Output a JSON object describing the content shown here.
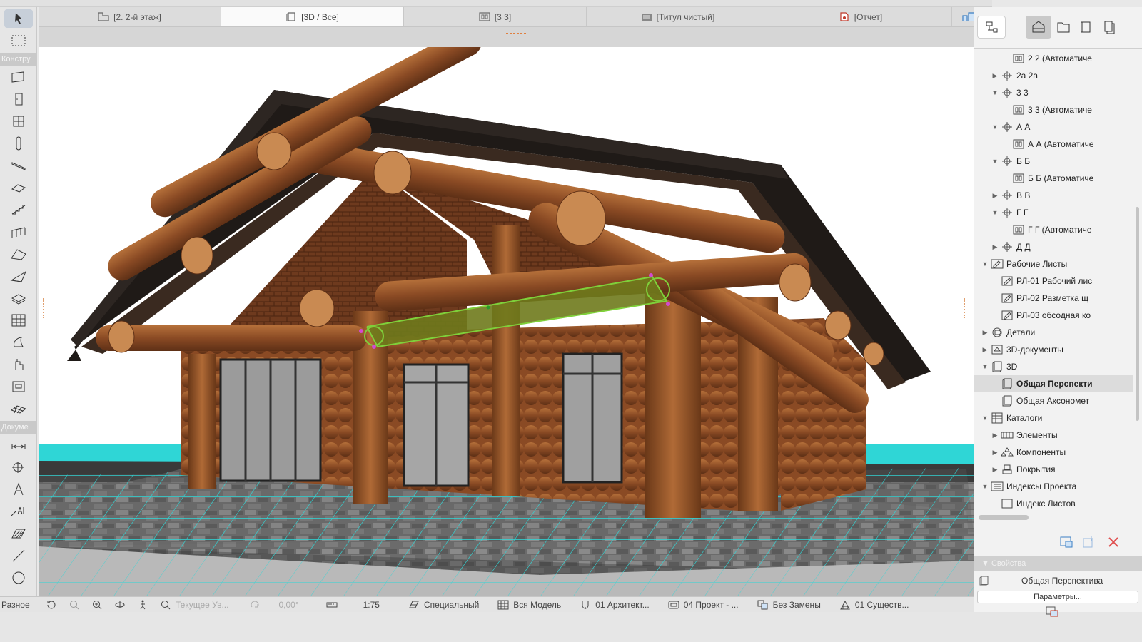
{
  "tabs": [
    {
      "label": "[2. 2-й этаж]",
      "icon": "floor-plan-icon",
      "active": false
    },
    {
      "label": "[3D / Все]",
      "icon": "3d-window-icon",
      "active": true
    },
    {
      "label": "[3 3]",
      "icon": "section-icon",
      "active": false
    },
    {
      "label": "[Титул чистый]",
      "icon": "layout-icon",
      "active": false
    },
    {
      "label": "[Отчет]",
      "icon": "report-icon",
      "active": false
    }
  ],
  "toolbox": {
    "section_design": "Констру",
    "section_document": "Докуме",
    "section_more": "Разное"
  },
  "navigator": {
    "tree": [
      {
        "label": "2 2 (Автоматиче",
        "level": 3,
        "arrow": "",
        "icon": "section-view-icon"
      },
      {
        "label": "2а 2а",
        "level": 2,
        "arrow": "▶",
        "icon": "section-marker-icon"
      },
      {
        "label": "3 3",
        "level": 2,
        "arrow": "▼",
        "icon": "section-marker-icon"
      },
      {
        "label": "3 3 (Автоматиче",
        "level": 3,
        "arrow": "",
        "icon": "section-view-icon"
      },
      {
        "label": "А А",
        "level": 2,
        "arrow": "▼",
        "icon": "section-marker-icon"
      },
      {
        "label": "А А (Автоматиче",
        "level": 3,
        "arrow": "",
        "icon": "section-view-icon"
      },
      {
        "label": "Б Б",
        "level": 2,
        "arrow": "▼",
        "icon": "section-marker-icon"
      },
      {
        "label": "Б Б (Автоматиче",
        "level": 3,
        "arrow": "",
        "icon": "section-view-icon"
      },
      {
        "label": "В В",
        "level": 2,
        "arrow": "▶",
        "icon": "section-marker-icon"
      },
      {
        "label": "Г Г",
        "level": 2,
        "arrow": "▼",
        "icon": "section-marker-icon"
      },
      {
        "label": "Г Г (Автоматиче",
        "level": 3,
        "arrow": "",
        "icon": "section-view-icon"
      },
      {
        "label": "Д Д",
        "level": 2,
        "arrow": "▶",
        "icon": "section-marker-icon"
      },
      {
        "label": "Рабочие Листы",
        "level": 1,
        "arrow": "▼",
        "icon": "worksheet-folder-icon"
      },
      {
        "label": "РЛ-01 Рабочий лис",
        "level": 2,
        "arrow": "",
        "icon": "worksheet-icon"
      },
      {
        "label": "РЛ-02 Разметка щ",
        "level": 2,
        "arrow": "",
        "icon": "worksheet-icon"
      },
      {
        "label": "РЛ-03 обсодная ко",
        "level": 2,
        "arrow": "",
        "icon": "worksheet-icon"
      },
      {
        "label": "Детали",
        "level": 1,
        "arrow": "▶",
        "icon": "details-icon"
      },
      {
        "label": "3D-документы",
        "level": 1,
        "arrow": "▶",
        "icon": "3d-document-icon"
      },
      {
        "label": "3D",
        "level": 1,
        "arrow": "▼",
        "icon": "3d-folder-icon"
      },
      {
        "label": "Общая Перспекти",
        "level": 2,
        "arrow": "",
        "icon": "perspective-icon",
        "selected": true
      },
      {
        "label": "Общая Аксономет",
        "level": 2,
        "arrow": "",
        "icon": "axonometry-icon"
      },
      {
        "label": "Каталоги",
        "level": 1,
        "arrow": "▼",
        "icon": "schedule-folder-icon"
      },
      {
        "label": "Элементы",
        "level": 2,
        "arrow": "▶",
        "icon": "elements-icon"
      },
      {
        "label": "Компоненты",
        "level": 2,
        "arrow": "▶",
        "icon": "components-icon"
      },
      {
        "label": "Покрытия",
        "level": 2,
        "arrow": "▶",
        "icon": "surfaces-icon"
      },
      {
        "label": "Индексы Проекта",
        "level": 1,
        "arrow": "▼",
        "icon": "index-folder-icon"
      },
      {
        "label": "Индекс Листов",
        "level": 2,
        "arrow": "",
        "icon": "index-icon"
      }
    ],
    "properties_header": "Свойства",
    "properties_value": "Общая Перспектива",
    "parameters_button": "Параметры..."
  },
  "statusbar": {
    "label_more": "Разное",
    "current_view": "Текущее Ув...",
    "angle": "0,00°",
    "scale": "1:75",
    "structure": "Специальный",
    "model": "Вся Модель",
    "layers": "01 Архитект...",
    "view_set": "04 Проект - ...",
    "override": "Без Замены",
    "renovation": "01 Существ..."
  },
  "colors": {
    "selection": "#7fd03a",
    "grid": "#2fd6d6",
    "log": "#8a4a24",
    "roof": "#1f1a17"
  }
}
